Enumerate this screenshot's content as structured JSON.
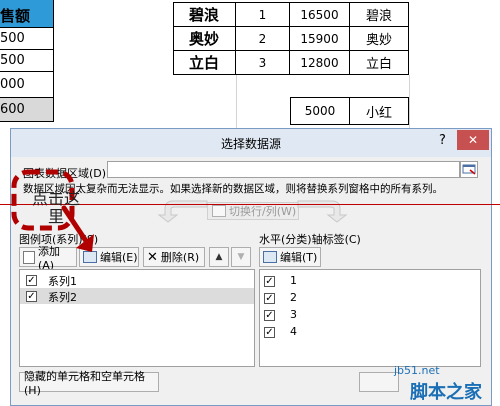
{
  "sheet": {
    "left_header": "售额",
    "left_col": [
      "500",
      "500",
      "000",
      "600"
    ],
    "rows": [
      {
        "name": "碧浪",
        "idx": "1",
        "val": "16500",
        "label": "碧浪"
      },
      {
        "name": "奥妙",
        "idx": "2",
        "val": "15900",
        "label": "奥妙"
      },
      {
        "name": "立白",
        "idx": "3",
        "val": "12800",
        "label": "立白"
      }
    ],
    "extra_val": "5000",
    "extra_label": "小红"
  },
  "dialog": {
    "title": "选择数据源",
    "help": "?",
    "close": "✕",
    "range_label": "图表数据区域(D):",
    "warning": "数据区域因太复杂而无法显示。如果选择新的数据区域，则将替换系列窗格中的所有系列。",
    "switch_btn": "切换行/列(W)",
    "legend_label": "图例项(系列)(S)",
    "add_btn": "添加(A)",
    "edit_btn": "编辑(E)",
    "delete_btn": "删除(R)",
    "series": [
      "系列1",
      "系列2"
    ],
    "axis_label": "水平(分类)轴标签(C)",
    "axis_edit_btn": "编辑(T)",
    "axis_items": [
      "1",
      "2",
      "3",
      "4"
    ],
    "hidden_btn": "隐藏的单元格和空单元格(H)"
  },
  "annotation": {
    "text_line1": "点击这",
    "text_line2": "里"
  },
  "watermark": {
    "url": "jb51.net",
    "name": "脚本之家"
  }
}
